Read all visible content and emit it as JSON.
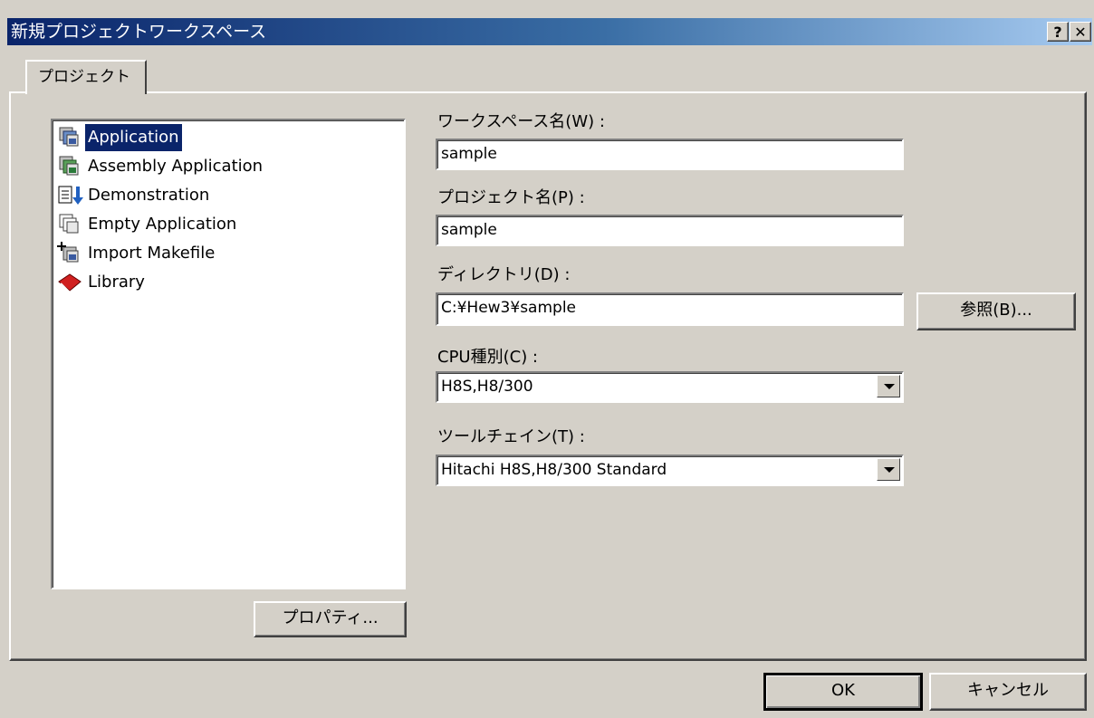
{
  "window": {
    "title": "新規プロジェクトワークスペース",
    "help_button": "?",
    "close_button": "✕"
  },
  "tab": {
    "label": "プロジェクト"
  },
  "project_types": [
    {
      "label": "Application",
      "icon": "application-icon",
      "selected": true
    },
    {
      "label": "Assembly Application",
      "icon": "assembly-application-icon",
      "selected": false
    },
    {
      "label": "Demonstration",
      "icon": "demonstration-icon",
      "selected": false
    },
    {
      "label": "Empty Application",
      "icon": "empty-application-icon",
      "selected": false
    },
    {
      "label": "Import Makefile",
      "icon": "import-makefile-icon",
      "selected": false
    },
    {
      "label": "Library",
      "icon": "library-icon",
      "selected": false
    }
  ],
  "properties_button": "プロパティ...",
  "form": {
    "workspace_label": "ワークスペース名(W) :",
    "workspace_value": "sample",
    "project_label": "プロジェクト名(P) :",
    "project_value": "sample",
    "directory_label": "ディレクトリ(D) :",
    "directory_value": "C:¥Hew3¥sample",
    "browse_button": "参照(B)...",
    "cpu_label": "CPU種別(C) :",
    "cpu_value": "H8S,H8/300",
    "toolchain_label": "ツールチェイン(T) :",
    "toolchain_value": "Hitachi H8S,H8/300 Standard"
  },
  "footer": {
    "ok_button": "OK",
    "cancel_button": "キャンセル"
  },
  "colors": {
    "face": "#d4d0c8",
    "selection": "#0a246a",
    "title_start": "#0a246a",
    "title_end": "#a6caf0"
  }
}
